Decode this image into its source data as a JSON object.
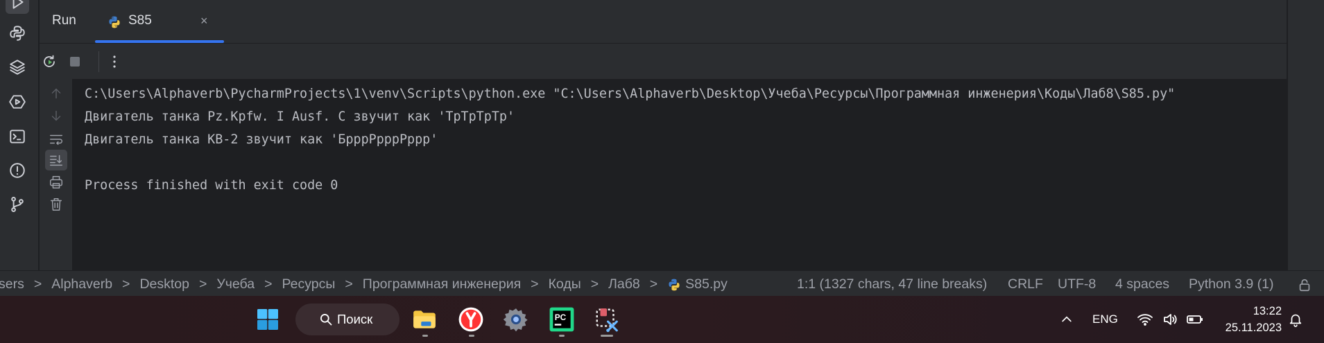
{
  "run_panel": {
    "tab_run_label": "Run",
    "tab_file_label": "S85",
    "tab_close": "×"
  },
  "console": {
    "lines": [
      "C:\\Users\\Alphaverb\\PycharmProjects\\1\\venv\\Scripts\\python.exe \"C:\\Users\\Alphaverb\\Desktop\\Учеба\\Ресурсы\\Программная инженерия\\Коды\\Лаб8\\S85.py\"",
      "Двигатель танка Pz.Kpfw. I Ausf. C звучит как 'ТрТрТрТр'",
      "Двигатель танка КВ-2 звучит как 'БрррРрррРррр'",
      "",
      "Process finished with exit code 0"
    ]
  },
  "status_bar": {
    "breadcrumbs": [
      "sers",
      "Alphaverb",
      "Desktop",
      "Учеба",
      "Ресурсы",
      "Программная инженерия",
      "Коды",
      "Лаб8",
      "S85.py"
    ],
    "crumb_separator": ">",
    "position": "1:1 (1327 chars, 47 line breaks)",
    "line_ending": "CRLF",
    "encoding": "UTF-8",
    "indent": "4 spaces",
    "interpreter": "Python 3.9 (1)"
  },
  "taskbar": {
    "search_label": "Поиск",
    "language": "ENG",
    "time": "13:22",
    "date": "25.11.2023",
    "pycharm_badge": "PC"
  },
  "colors": {
    "accent": "#3574f0",
    "run_green": "#5fb865",
    "python_blue": "#3f7cc9",
    "python_yellow": "#f2c94c"
  }
}
